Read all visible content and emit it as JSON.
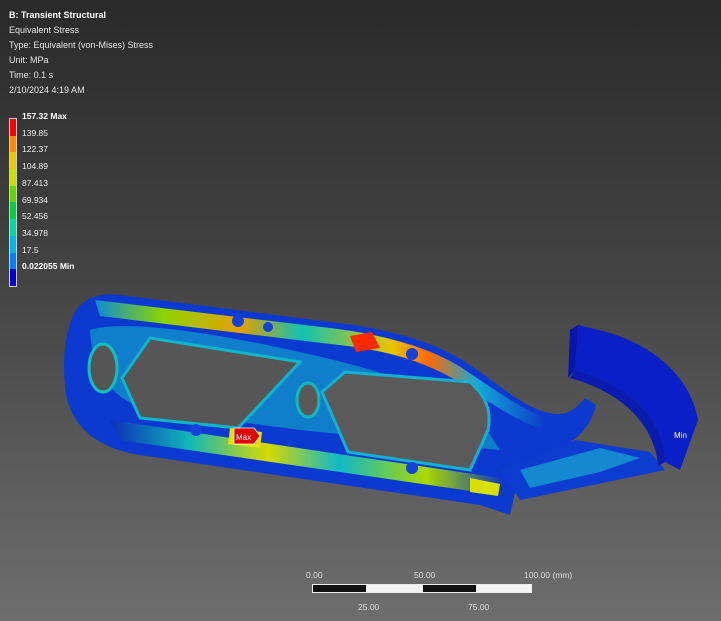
{
  "info": {
    "title": "B: Transient Structural",
    "result": "Equivalent Stress",
    "type": "Type: Equivalent (von-Mises) Stress",
    "unit": "Unit: MPa",
    "time": "Time: 0.1 s",
    "date": "2/10/2024 4:19 AM"
  },
  "legend": {
    "max_label": "157.32 Max",
    "min_label": "0.022055 Min",
    "intermediate": [
      "139.85",
      "122.37",
      "104.89",
      "87.413",
      "69.934",
      "52.456",
      "34.978",
      "17.5"
    ],
    "colors": [
      "#ff0000",
      "#ff8c00",
      "#e8c800",
      "#c8e000",
      "#60d800",
      "#00d040",
      "#00d8a0",
      "#00b8e8",
      "#0080ff",
      "#0000d0"
    ]
  },
  "probes": {
    "max_tag": "Max",
    "min_tag": "Min"
  },
  "scale": {
    "ticks_top": [
      "0.00",
      "50.00",
      "100.00 (mm)"
    ],
    "ticks_bottom": [
      "25.00",
      "75.00"
    ]
  }
}
